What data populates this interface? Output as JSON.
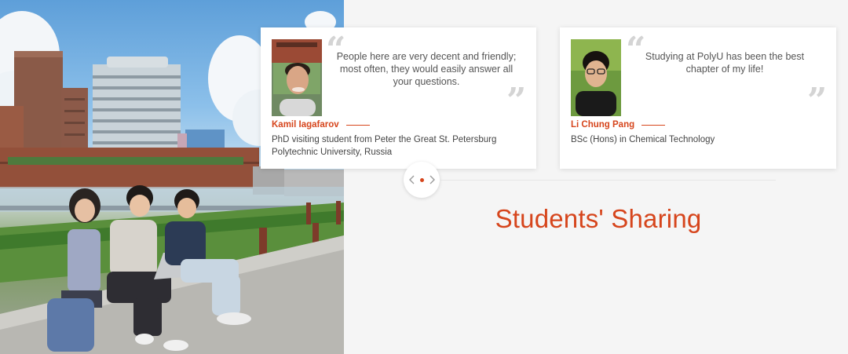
{
  "section": {
    "title": "Students' Sharing"
  },
  "testimonials": [
    {
      "quote": "People here are very decent and friendly; most often, they would easily answer all your questions.",
      "name": "Kamil Iagafarov",
      "role": "PhD visiting student from Peter the Great St. Petersburg Polytechnic University, Russia",
      "avatar_icon": "student-portrait-photo"
    },
    {
      "quote": "Studying at PolyU has been the best chapter of my life!",
      "name": "Li Chung Pang",
      "role": "BSc (Hons) in Chemical Technology",
      "avatar_icon": "student-portrait-photo"
    }
  ],
  "slider": {
    "prev_icon": "chevron-left-icon",
    "next_icon": "chevron-right-icon",
    "indicator_icon": "dot-indicator-icon"
  },
  "colors": {
    "accent": "#d6451c",
    "background": "#f5f5f5",
    "card": "#ffffff",
    "quote_mark": "#d4d4d4"
  }
}
